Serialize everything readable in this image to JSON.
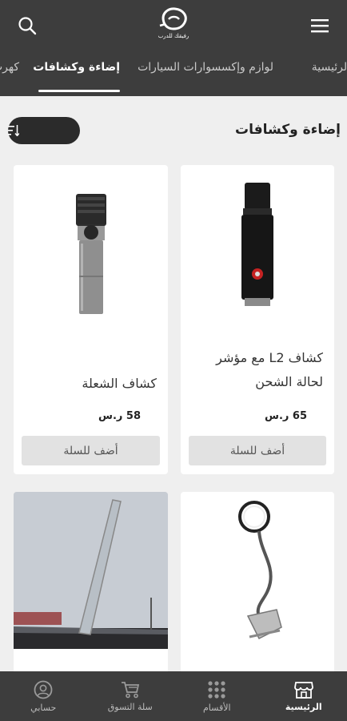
{
  "header": {
    "logo_text": "رفيقك للدرب",
    "tabs": [
      {
        "label": "الرئيسية",
        "active": false
      },
      {
        "label": "لوازم وإكسسوارات السيارات",
        "active": false
      },
      {
        "label": "إضاءة وكشافات",
        "active": true
      },
      {
        "label": "كهرب",
        "active": false
      }
    ]
  },
  "section": {
    "title": "إضاءة وكشافات"
  },
  "products": [
    {
      "name_line1": "كشاف L2 مع مؤشر",
      "name_line2": "لحالة الشحن",
      "price": "65 ر.س",
      "add_label": "أضف للسلة"
    },
    {
      "name_line1": "كشاف الشعلة",
      "name_line2": "",
      "price": "58 ر.س",
      "add_label": "أضف للسلة"
    },
    {
      "name_line1": "",
      "name_line2": "",
      "price": "",
      "add_label": ""
    },
    {
      "name_line1": "",
      "name_line2": "",
      "price": "",
      "add_label": ""
    }
  ],
  "bottom_nav": [
    {
      "label": "الرئيسية",
      "icon": "store-icon",
      "active": true
    },
    {
      "label": "الأقسام",
      "icon": "grid-icon",
      "active": false
    },
    {
      "label": "سلة التسوق",
      "icon": "cart-icon",
      "active": false
    },
    {
      "label": "حسابي",
      "icon": "user-icon",
      "active": false
    }
  ],
  "colors": {
    "header_bg": "#3d3d3d",
    "page_bg": "#efefef",
    "button_bg": "#e2e2e2",
    "sort_bg": "#2b2b2b"
  }
}
